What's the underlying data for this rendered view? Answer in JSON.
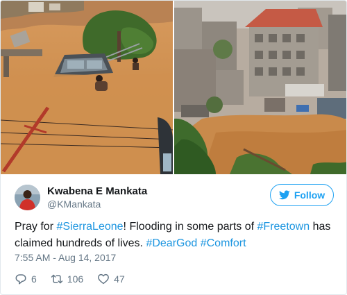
{
  "media": {
    "photos": [
      {
        "subject": "flooded street with submerged car and people in brown floodwater"
      },
      {
        "subject": "aerial view of flooded hillside town with buildings"
      }
    ]
  },
  "author": {
    "display_name": "Kwabena E Mankata",
    "handle": "@KMankata",
    "follow_label": "Follow"
  },
  "tweet": {
    "parts": [
      {
        "text": "Pray for ",
        "hashtag": false
      },
      {
        "text": "#SierraLeone",
        "hashtag": true
      },
      {
        "text": "! Flooding in some parts of ",
        "hashtag": false
      },
      {
        "text": "#Freetown",
        "hashtag": true
      },
      {
        "text": " has claimed hundreds of lives. ",
        "hashtag": false
      },
      {
        "text": "#DearGod",
        "hashtag": true
      },
      {
        "text": " ",
        "hashtag": false
      },
      {
        "text": "#Comfort",
        "hashtag": true
      }
    ],
    "timestamp": "7:55 AM - Aug 14, 2017"
  },
  "actions": {
    "replies": "6",
    "retweets": "106",
    "likes": "47"
  },
  "colors": {
    "accent": "#1da1f2",
    "hashtag": "#1b95e0",
    "muted": "#657786",
    "text": "#14171a",
    "flood_water": "#c98a4b"
  },
  "icons": {
    "follow": "twitter-bird-icon",
    "reply": "reply-icon",
    "retweet": "retweet-icon",
    "like": "heart-icon"
  }
}
